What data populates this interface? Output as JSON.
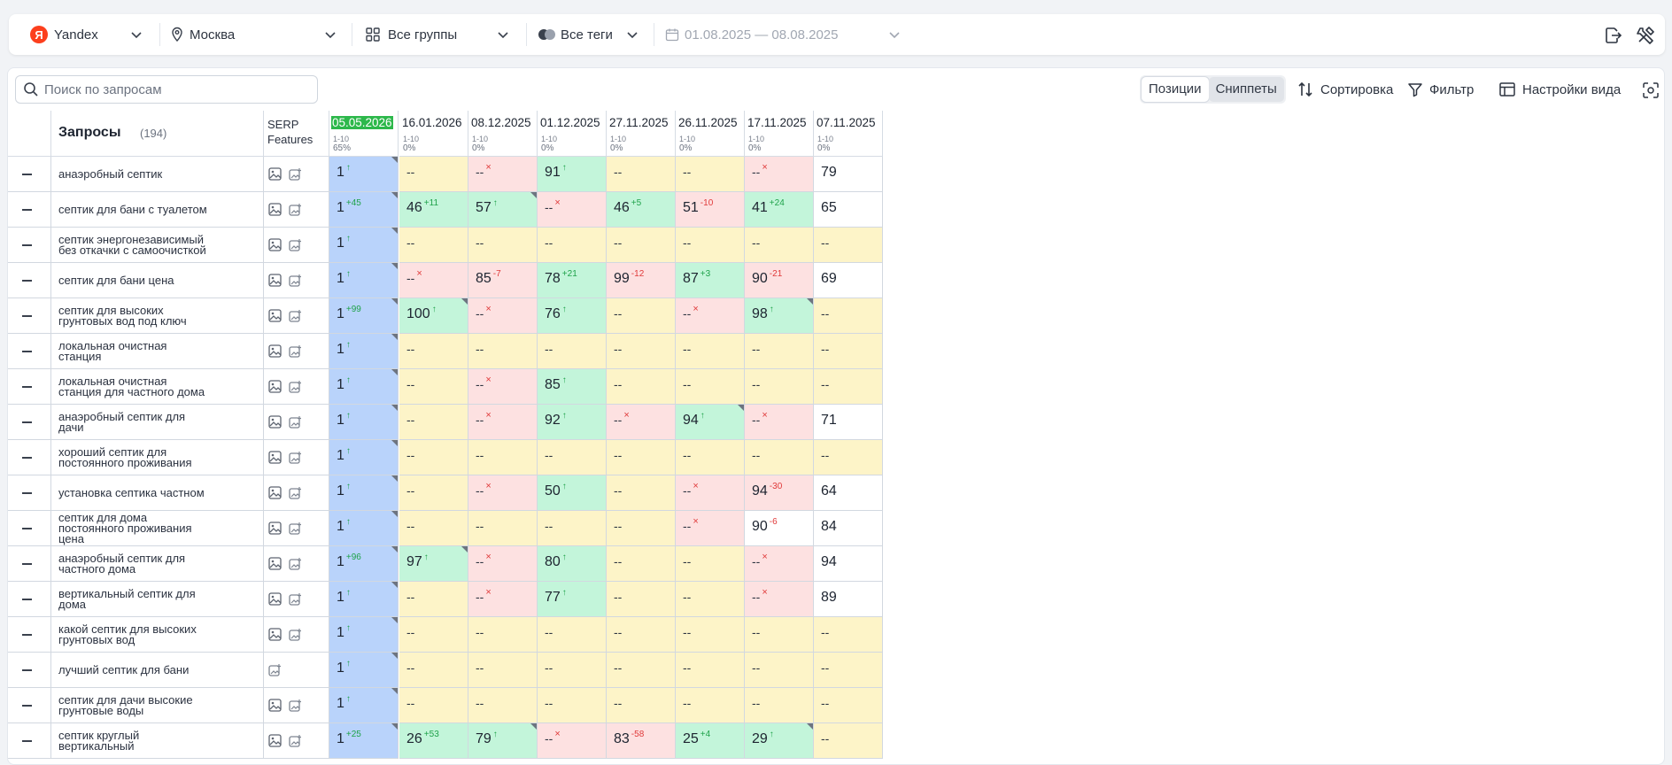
{
  "topbar": {
    "engine": "Yandex",
    "region": "Москва",
    "groups": "Все группы",
    "tags": "Все теги",
    "date_range": "01.08.2025 — 08.08.2025"
  },
  "toolbar": {
    "search_placeholder": "Поиск по запросам",
    "view_positions": "Позиции",
    "view_snippets": "Сниппеты",
    "sort": "Сортировка",
    "filter": "Фильтр",
    "view_settings": "Настройки вида"
  },
  "table": {
    "queries_label": "Запросы",
    "queries_count": "(194)",
    "serp_label_1": "SERP",
    "serp_label_2": "Features",
    "columns": [
      {
        "date": "05.05.2026",
        "range": "1-10",
        "pct": "65%",
        "current": true
      },
      {
        "date": "16.01.2026",
        "range": "1-10",
        "pct": "0%"
      },
      {
        "date": "08.12.2025",
        "range": "1-10",
        "pct": "0%"
      },
      {
        "date": "01.12.2025",
        "range": "1-10",
        "pct": "0%"
      },
      {
        "date": "27.11.2025",
        "range": "1-10",
        "pct": "0%"
      },
      {
        "date": "26.11.2025",
        "range": "1-10",
        "pct": "0%"
      },
      {
        "date": "17.11.2025",
        "range": "1-10",
        "pct": "0%"
      },
      {
        "date": "07.11.2025",
        "range": "1-10",
        "pct": "0%"
      }
    ],
    "rows": [
      {
        "q": [
          "анаэробный септик"
        ],
        "img": true,
        "cells": [
          [
            "1",
            "↑",
            "up",
            "b",
            1
          ],
          [
            "--",
            "",
            "",
            "y",
            0
          ],
          [
            "--",
            "×",
            "x",
            "r",
            0
          ],
          [
            "91",
            "↑",
            "up",
            "g",
            0
          ],
          [
            "--",
            "",
            "",
            "y",
            0
          ],
          [
            "--",
            "",
            "",
            "y",
            0
          ],
          [
            "--",
            "×",
            "x",
            "r",
            0
          ],
          [
            "79",
            "",
            "",
            "w",
            0
          ]
        ]
      },
      {
        "q": [
          "септик для бани с туалетом"
        ],
        "img": true,
        "cells": [
          [
            "1",
            "+45",
            "up",
            "b",
            1
          ],
          [
            "46",
            "+11",
            "up",
            "g",
            0
          ],
          [
            "57",
            "↑",
            "up",
            "g",
            1
          ],
          [
            "--",
            "×",
            "x",
            "r",
            0
          ],
          [
            "46",
            "+5",
            "up",
            "g",
            0
          ],
          [
            "51",
            "-10",
            "down",
            "r",
            0
          ],
          [
            "41",
            "+24",
            "up",
            "g",
            0
          ],
          [
            "65",
            "",
            "",
            "w",
            0
          ]
        ]
      },
      {
        "q": [
          "септик энергонезависимый",
          "без откачки с самоочисткой"
        ],
        "img": true,
        "cells": [
          [
            "1",
            "↑",
            "up",
            "b",
            1
          ],
          [
            "--",
            "",
            "",
            "y",
            0
          ],
          [
            "--",
            "",
            "",
            "y",
            0
          ],
          [
            "--",
            "",
            "",
            "y",
            0
          ],
          [
            "--",
            "",
            "",
            "y",
            0
          ],
          [
            "--",
            "",
            "",
            "y",
            0
          ],
          [
            "--",
            "",
            "",
            "y",
            0
          ],
          [
            "--",
            "",
            "",
            "y",
            0
          ]
        ]
      },
      {
        "q": [
          "септик для бани цена"
        ],
        "img": true,
        "cells": [
          [
            "1",
            "↑",
            "up",
            "b",
            1
          ],
          [
            "--",
            "×",
            "x",
            "r",
            0
          ],
          [
            "85",
            "-7",
            "down",
            "r",
            0
          ],
          [
            "78",
            "+21",
            "up",
            "g",
            0
          ],
          [
            "99",
            "-12",
            "down",
            "r",
            0
          ],
          [
            "87",
            "+3",
            "up",
            "g",
            0
          ],
          [
            "90",
            "-21",
            "down",
            "r",
            0
          ],
          [
            "69",
            "",
            "",
            "w",
            0
          ]
        ]
      },
      {
        "q": [
          "септик для высоких",
          "грунтовых вод под ключ"
        ],
        "img": true,
        "cells": [
          [
            "1",
            "+99",
            "up",
            "b",
            1
          ],
          [
            "100",
            "↑",
            "up",
            "g",
            1
          ],
          [
            "--",
            "×",
            "x",
            "r",
            0
          ],
          [
            "76",
            "↑",
            "up",
            "g",
            0
          ],
          [
            "--",
            "",
            "",
            "y",
            0
          ],
          [
            "--",
            "×",
            "x",
            "r",
            0
          ],
          [
            "98",
            "↑",
            "up",
            "g",
            1
          ],
          [
            "--",
            "",
            "",
            "y",
            0
          ]
        ]
      },
      {
        "q": [
          "локальная очистная",
          "станция"
        ],
        "img": true,
        "cells": [
          [
            "1",
            "↑",
            "up",
            "b",
            1
          ],
          [
            "--",
            "",
            "",
            "y",
            0
          ],
          [
            "--",
            "",
            "",
            "y",
            0
          ],
          [
            "--",
            "",
            "",
            "y",
            0
          ],
          [
            "--",
            "",
            "",
            "y",
            0
          ],
          [
            "--",
            "",
            "",
            "y",
            0
          ],
          [
            "--",
            "",
            "",
            "y",
            0
          ],
          [
            "--",
            "",
            "",
            "y",
            0
          ]
        ]
      },
      {
        "q": [
          "локальная очистная",
          "станция для частного дома"
        ],
        "img": true,
        "cells": [
          [
            "1",
            "↑",
            "up",
            "b",
            1
          ],
          [
            "--",
            "",
            "",
            "y",
            0
          ],
          [
            "--",
            "×",
            "x",
            "r",
            0
          ],
          [
            "85",
            "↑",
            "up",
            "g",
            0
          ],
          [
            "--",
            "",
            "",
            "y",
            0
          ],
          [
            "--",
            "",
            "",
            "y",
            0
          ],
          [
            "--",
            "",
            "",
            "y",
            0
          ],
          [
            "--",
            "",
            "",
            "y",
            0
          ]
        ]
      },
      {
        "q": [
          "анаэробный септик для",
          "дачи"
        ],
        "img": true,
        "cells": [
          [
            "1",
            "↑",
            "up",
            "b",
            1
          ],
          [
            "--",
            "",
            "",
            "y",
            0
          ],
          [
            "--",
            "×",
            "x",
            "r",
            0
          ],
          [
            "92",
            "↑",
            "up",
            "g",
            0
          ],
          [
            "--",
            "×",
            "x",
            "r",
            0
          ],
          [
            "94",
            "↑",
            "up",
            "g",
            1
          ],
          [
            "--",
            "×",
            "x",
            "r",
            0
          ],
          [
            "71",
            "",
            "",
            "w",
            0
          ]
        ]
      },
      {
        "q": [
          "хороший септик для",
          "постоянного проживания"
        ],
        "img": true,
        "cells": [
          [
            "1",
            "↑",
            "up",
            "b",
            1
          ],
          [
            "--",
            "",
            "",
            "y",
            0
          ],
          [
            "--",
            "",
            "",
            "y",
            0
          ],
          [
            "--",
            "",
            "",
            "y",
            0
          ],
          [
            "--",
            "",
            "",
            "y",
            0
          ],
          [
            "--",
            "",
            "",
            "y",
            0
          ],
          [
            "--",
            "",
            "",
            "y",
            0
          ],
          [
            "--",
            "",
            "",
            "y",
            0
          ]
        ]
      },
      {
        "q": [
          "установка септика частном"
        ],
        "img": true,
        "cells": [
          [
            "1",
            "↑",
            "up",
            "b",
            1
          ],
          [
            "--",
            "",
            "",
            "y",
            0
          ],
          [
            "--",
            "×",
            "x",
            "r",
            0
          ],
          [
            "50",
            "↑",
            "up",
            "g",
            0
          ],
          [
            "--",
            "",
            "",
            "y",
            0
          ],
          [
            "--",
            "×",
            "x",
            "r",
            0
          ],
          [
            "94",
            "-30",
            "down",
            "r",
            0
          ],
          [
            "64",
            "",
            "",
            "w",
            0
          ]
        ]
      },
      {
        "q": [
          "септик для дома",
          "постоянного проживания",
          "цена"
        ],
        "img": true,
        "cells": [
          [
            "1",
            "↑",
            "up",
            "b",
            1
          ],
          [
            "--",
            "",
            "",
            "y",
            0
          ],
          [
            "--",
            "",
            "",
            "y",
            0
          ],
          [
            "--",
            "",
            "",
            "y",
            0
          ],
          [
            "--",
            "",
            "",
            "y",
            0
          ],
          [
            "--",
            "×",
            "x",
            "r",
            0
          ],
          [
            "90",
            "-6",
            "down",
            "w",
            0
          ],
          [
            "84",
            "",
            "",
            "w",
            0
          ]
        ]
      },
      {
        "q": [
          "анаэробный септик для",
          "частного дома"
        ],
        "img": true,
        "cells": [
          [
            "1",
            "+96",
            "up",
            "b",
            1
          ],
          [
            "97",
            "↑",
            "up",
            "g",
            1
          ],
          [
            "--",
            "×",
            "x",
            "r",
            0
          ],
          [
            "80",
            "↑",
            "up",
            "g",
            0
          ],
          [
            "--",
            "",
            "",
            "y",
            0
          ],
          [
            "--",
            "",
            "",
            "y",
            0
          ],
          [
            "--",
            "×",
            "x",
            "r",
            0
          ],
          [
            "94",
            "",
            "",
            "w",
            0
          ]
        ]
      },
      {
        "q": [
          "вертикальный септик для",
          "дома"
        ],
        "img": true,
        "cells": [
          [
            "1",
            "↑",
            "up",
            "b",
            1
          ],
          [
            "--",
            "",
            "",
            "y",
            0
          ],
          [
            "--",
            "×",
            "x",
            "r",
            0
          ],
          [
            "77",
            "↑",
            "up",
            "g",
            0
          ],
          [
            "--",
            "",
            "",
            "y",
            0
          ],
          [
            "--",
            "",
            "",
            "y",
            0
          ],
          [
            "--",
            "×",
            "x",
            "r",
            0
          ],
          [
            "89",
            "",
            "",
            "w",
            0
          ]
        ]
      },
      {
        "q": [
          "какой септик для высоких",
          "грунтовых вод"
        ],
        "img": true,
        "cells": [
          [
            "1",
            "↑",
            "up",
            "b",
            1
          ],
          [
            "--",
            "",
            "",
            "y",
            0
          ],
          [
            "--",
            "",
            "",
            "y",
            0
          ],
          [
            "--",
            "",
            "",
            "y",
            0
          ],
          [
            "--",
            "",
            "",
            "y",
            0
          ],
          [
            "--",
            "",
            "",
            "y",
            0
          ],
          [
            "--",
            "",
            "",
            "y",
            0
          ],
          [
            "--",
            "",
            "",
            "y",
            0
          ]
        ]
      },
      {
        "q": [
          "лучший септик для бани"
        ],
        "img": false,
        "cells": [
          [
            "1",
            "↑",
            "up",
            "b",
            1
          ],
          [
            "--",
            "",
            "",
            "y",
            0
          ],
          [
            "--",
            "",
            "",
            "y",
            0
          ],
          [
            "--",
            "",
            "",
            "y",
            0
          ],
          [
            "--",
            "",
            "",
            "y",
            0
          ],
          [
            "--",
            "",
            "",
            "y",
            0
          ],
          [
            "--",
            "",
            "",
            "y",
            0
          ],
          [
            "--",
            "",
            "",
            "y",
            0
          ]
        ]
      },
      {
        "q": [
          "септик для дачи высокие",
          "грунтовые воды"
        ],
        "img": true,
        "cells": [
          [
            "1",
            "↑",
            "up",
            "b",
            1
          ],
          [
            "--",
            "",
            "",
            "y",
            0
          ],
          [
            "--",
            "",
            "",
            "y",
            0
          ],
          [
            "--",
            "",
            "",
            "y",
            0
          ],
          [
            "--",
            "",
            "",
            "y",
            0
          ],
          [
            "--",
            "",
            "",
            "y",
            0
          ],
          [
            "--",
            "",
            "",
            "y",
            0
          ],
          [
            "--",
            "",
            "",
            "y",
            0
          ]
        ]
      },
      {
        "q": [
          "септик круглый",
          "вертикальный"
        ],
        "img": true,
        "cells": [
          [
            "1",
            "+25",
            "up",
            "b",
            1
          ],
          [
            "26",
            "+53",
            "up",
            "g",
            0
          ],
          [
            "79",
            "↑",
            "up",
            "g",
            1
          ],
          [
            "--",
            "×",
            "x",
            "r",
            0
          ],
          [
            "83",
            "-58",
            "down",
            "r",
            0
          ],
          [
            "25",
            "+4",
            "up",
            "g",
            0
          ],
          [
            "29",
            "↑",
            "up",
            "g",
            1
          ],
          [
            "--",
            "",
            "",
            "y",
            0
          ]
        ]
      }
    ]
  },
  "colors": {
    "accent": "#2db84b",
    "blue_cell": "#b9d3fb",
    "yellow_cell": "#fdf4c8",
    "green_cell": "#c3f5da",
    "red_cell": "#fde1e1",
    "white_cell": "#ffffff"
  }
}
